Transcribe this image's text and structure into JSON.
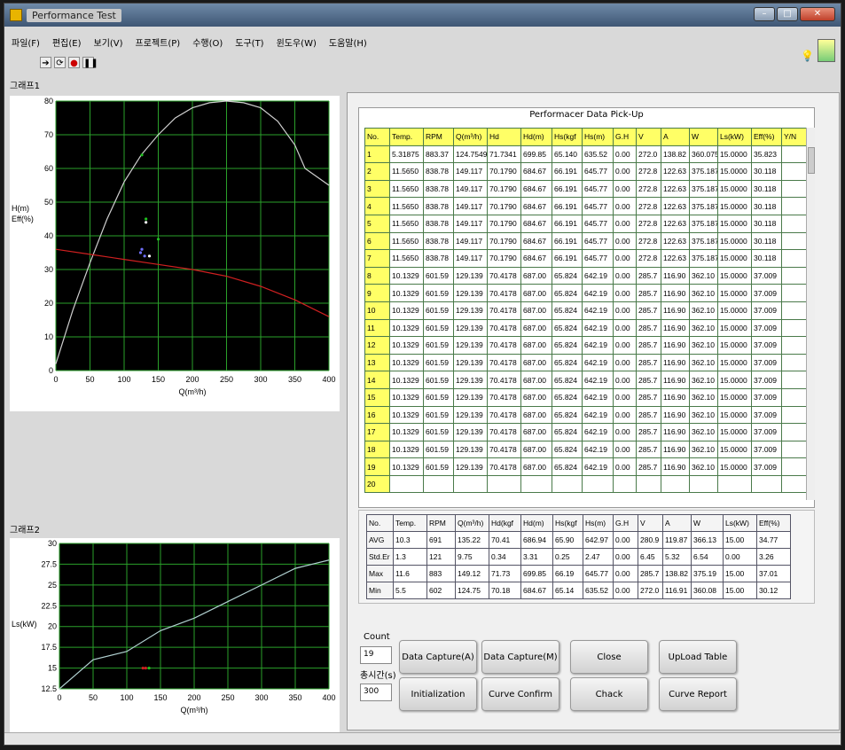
{
  "window": {
    "title": "Performance Test"
  },
  "menu": [
    "파일(F)",
    "편집(E)",
    "보기(V)",
    "프로젝트(P)",
    "수행(O)",
    "도구(T)",
    "윈도우(W)",
    "도움말(H)"
  ],
  "toolbar": {
    "icons": [
      "run-arrow-icon",
      "run-continuous-icon",
      "abort-icon",
      "pause-icon"
    ]
  },
  "graph1": {
    "label": "그래프1",
    "ylabel_1": "H(m)",
    "ylabel_2": "Eff(%)",
    "xlabel": "Q(m³/h)",
    "xticks": [
      "0",
      "50",
      "100",
      "150",
      "200",
      "250",
      "300",
      "350",
      "400"
    ],
    "yticks": [
      "0",
      "10",
      "20",
      "30",
      "40",
      "50",
      "60",
      "70",
      "80"
    ]
  },
  "graph2": {
    "label": "그래프2",
    "ylabel": "Ls(kW)",
    "xlabel": "Q(m³/h)",
    "xticks": [
      "0",
      "50",
      "100",
      "150",
      "200",
      "250",
      "300",
      "350",
      "400"
    ],
    "yticks": [
      "12.5",
      "15",
      "17.5",
      "20",
      "22.5",
      "25",
      "27.5",
      "30"
    ]
  },
  "chart_data": [
    {
      "type": "line",
      "xlabel": "Q(m³/h)",
      "ylabel": "H(m) / Eff(%)",
      "xlim": [
        0,
        400
      ],
      "ylim": [
        0,
        80
      ],
      "grid": true,
      "series": [
        {
          "color": "#d0d0d0",
          "x": [
            0,
            25,
            50,
            75,
            100,
            125,
            150,
            175,
            200,
            225,
            250,
            275,
            300,
            325,
            350,
            365,
            400
          ],
          "y": [
            2,
            18,
            32,
            45,
            56,
            64,
            70,
            75,
            78,
            79.5,
            80,
            79.5,
            78,
            74,
            67,
            60,
            55
          ]
        },
        {
          "color": "#d02020",
          "x": [
            0,
            50,
            100,
            150,
            200,
            250,
            300,
            350,
            400
          ],
          "y": [
            36,
            34.5,
            33,
            31.5,
            30,
            28,
            25,
            21,
            16
          ]
        },
        {
          "color": "#20c020",
          "x": [
            126,
            132,
            150
          ],
          "y": [
            64,
            45,
            39
          ]
        },
        {
          "color": "#7070ff",
          "x": [
            124,
            126,
            130
          ],
          "y": [
            35,
            36,
            34
          ]
        },
        {
          "color": "#ffffff",
          "x": [
            132,
            137
          ],
          "y": [
            44,
            34
          ]
        }
      ]
    },
    {
      "type": "line",
      "xlabel": "Q(m³/h)",
      "ylabel": "Ls(kW)",
      "xlim": [
        0,
        400
      ],
      "ylim": [
        12.5,
        30
      ],
      "grid": true,
      "series": [
        {
          "color": "#b0d0d0",
          "x": [
            0,
            50,
            100,
            150,
            200,
            250,
            300,
            350,
            400
          ],
          "y": [
            12.5,
            16,
            17,
            19.5,
            21,
            23,
            25,
            27,
            28
          ]
        },
        {
          "color": "#d02020",
          "x": [
            124,
            128
          ],
          "y": [
            15,
            15
          ]
        },
        {
          "color": "#20c020",
          "x": [
            133
          ],
          "y": [
            15
          ]
        }
      ]
    }
  ],
  "pickup": {
    "title": "Performacer Data Pick-Up",
    "headers": [
      "No.",
      "Temp.",
      "RPM",
      "Q(m³/h)",
      "Hd",
      "Hd(m)",
      "Hs(kgf",
      "Hs(m)",
      "G.H",
      "V",
      "A",
      "W",
      "Ls(kW)",
      "Eff(%)",
      "Y/N"
    ],
    "rows": [
      [
        "1",
        "5.31875",
        "883.37",
        "124.7549",
        "71.7341",
        "699.85",
        "65.140",
        "635.52",
        "0.00",
        "272.0",
        "138.82",
        "360.075",
        "15.0000",
        "35.823",
        ""
      ],
      [
        "2",
        "11.5650",
        "838.78",
        "149.117",
        "70.1790",
        "684.67",
        "66.191",
        "645.77",
        "0.00",
        "272.8",
        "122.63",
        "375.187",
        "15.0000",
        "30.118",
        ""
      ],
      [
        "3",
        "11.5650",
        "838.78",
        "149.117",
        "70.1790",
        "684.67",
        "66.191",
        "645.77",
        "0.00",
        "272.8",
        "122.63",
        "375.187",
        "15.0000",
        "30.118",
        ""
      ],
      [
        "4",
        "11.5650",
        "838.78",
        "149.117",
        "70.1790",
        "684.67",
        "66.191",
        "645.77",
        "0.00",
        "272.8",
        "122.63",
        "375.187",
        "15.0000",
        "30.118",
        ""
      ],
      [
        "5",
        "11.5650",
        "838.78",
        "149.117",
        "70.1790",
        "684.67",
        "66.191",
        "645.77",
        "0.00",
        "272.8",
        "122.63",
        "375.187",
        "15.0000",
        "30.118",
        ""
      ],
      [
        "6",
        "11.5650",
        "838.78",
        "149.117",
        "70.1790",
        "684.67",
        "66.191",
        "645.77",
        "0.00",
        "272.8",
        "122.63",
        "375.187",
        "15.0000",
        "30.118",
        ""
      ],
      [
        "7",
        "11.5650",
        "838.78",
        "149.117",
        "70.1790",
        "684.67",
        "66.191",
        "645.77",
        "0.00",
        "272.8",
        "122.63",
        "375.187",
        "15.0000",
        "30.118",
        ""
      ],
      [
        "8",
        "10.1329",
        "601.59",
        "129.139",
        "70.4178",
        "687.00",
        "65.824",
        "642.19",
        "0.00",
        "285.7",
        "116.90",
        "362.10",
        "15.0000",
        "37.009",
        ""
      ],
      [
        "9",
        "10.1329",
        "601.59",
        "129.139",
        "70.4178",
        "687.00",
        "65.824",
        "642.19",
        "0.00",
        "285.7",
        "116.90",
        "362.10",
        "15.0000",
        "37.009",
        ""
      ],
      [
        "10",
        "10.1329",
        "601.59",
        "129.139",
        "70.4178",
        "687.00",
        "65.824",
        "642.19",
        "0.00",
        "285.7",
        "116.90",
        "362.10",
        "15.0000",
        "37.009",
        ""
      ],
      [
        "11",
        "10.1329",
        "601.59",
        "129.139",
        "70.4178",
        "687.00",
        "65.824",
        "642.19",
        "0.00",
        "285.7",
        "116.90",
        "362.10",
        "15.0000",
        "37.009",
        ""
      ],
      [
        "12",
        "10.1329",
        "601.59",
        "129.139",
        "70.4178",
        "687.00",
        "65.824",
        "642.19",
        "0.00",
        "285.7",
        "116.90",
        "362.10",
        "15.0000",
        "37.009",
        ""
      ],
      [
        "13",
        "10.1329",
        "601.59",
        "129.139",
        "70.4178",
        "687.00",
        "65.824",
        "642.19",
        "0.00",
        "285.7",
        "116.90",
        "362.10",
        "15.0000",
        "37.009",
        ""
      ],
      [
        "14",
        "10.1329",
        "601.59",
        "129.139",
        "70.4178",
        "687.00",
        "65.824",
        "642.19",
        "0.00",
        "285.7",
        "116.90",
        "362.10",
        "15.0000",
        "37.009",
        ""
      ],
      [
        "15",
        "10.1329",
        "601.59",
        "129.139",
        "70.4178",
        "687.00",
        "65.824",
        "642.19",
        "0.00",
        "285.7",
        "116.90",
        "362.10",
        "15.0000",
        "37.009",
        ""
      ],
      [
        "16",
        "10.1329",
        "601.59",
        "129.139",
        "70.4178",
        "687.00",
        "65.824",
        "642.19",
        "0.00",
        "285.7",
        "116.90",
        "362.10",
        "15.0000",
        "37.009",
        ""
      ],
      [
        "17",
        "10.1329",
        "601.59",
        "129.139",
        "70.4178",
        "687.00",
        "65.824",
        "642.19",
        "0.00",
        "285.7",
        "116.90",
        "362.10",
        "15.0000",
        "37.009",
        ""
      ],
      [
        "18",
        "10.1329",
        "601.59",
        "129.139",
        "70.4178",
        "687.00",
        "65.824",
        "642.19",
        "0.00",
        "285.7",
        "116.90",
        "362.10",
        "15.0000",
        "37.009",
        ""
      ],
      [
        "19",
        "10.1329",
        "601.59",
        "129.139",
        "70.4178",
        "687.00",
        "65.824",
        "642.19",
        "0.00",
        "285.7",
        "116.90",
        "362.10",
        "15.0000",
        "37.009",
        ""
      ],
      [
        "20",
        "",
        "",
        "",
        "",
        "",
        "",
        "",
        "",
        "",
        "",
        "",
        "",
        "",
        ""
      ]
    ]
  },
  "stats": {
    "headers": [
      "No.",
      "Temp.",
      "RPM",
      "Q(m³/h)",
      "Hd(kgf",
      "Hd(m)",
      "Hs(kgf",
      "Hs(m)",
      "G.H",
      "V",
      "A",
      "W",
      "Ls(kW)",
      "Eff(%)"
    ],
    "rows": [
      [
        "AVG",
        "10.3",
        "691",
        "135.22",
        "70.41",
        "686.94",
        "65.90",
        "642.97",
        "0.00",
        "280.9",
        "119.87",
        "366.13",
        "15.00",
        "34.77"
      ],
      [
        "Std.Er",
        "1.3",
        "121",
        "9.75",
        "0.34",
        "3.31",
        "0.25",
        "2.47",
        "0.00",
        "6.45",
        "5.32",
        "6.54",
        "0.00",
        "3.26"
      ],
      [
        "Max",
        "11.6",
        "883",
        "149.12",
        "71.73",
        "699.85",
        "66.19",
        "645.77",
        "0.00",
        "285.7",
        "138.82",
        "375.19",
        "15.00",
        "37.01"
      ],
      [
        "Min",
        "5.5",
        "602",
        "124.75",
        "70.18",
        "684.67",
        "65.14",
        "635.52",
        "0.00",
        "272.0",
        "116.91",
        "360.08",
        "15.00",
        "30.12"
      ]
    ]
  },
  "controls": {
    "count_label": "Count",
    "count_value": "19",
    "time_label": "총시간(s)",
    "time_value": "300",
    "btn_capture_a": "Data Capture(A)",
    "btn_capture_m": "Data Capture(M)",
    "btn_close": "Close",
    "btn_upload": "UpLoad Table",
    "btn_init": "Initialization",
    "btn_curve_confirm": "Curve Confirm",
    "btn_chack": "Chack",
    "btn_curve_report": "Curve Report"
  }
}
